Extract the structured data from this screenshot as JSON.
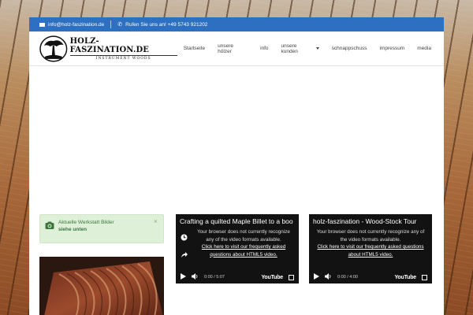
{
  "topbar": {
    "email": "info@holz-faszination.de",
    "phone_label": "Rufen Sie uns an! +49 5743 921202"
  },
  "logo": {
    "title": "HOLZ-FASZINATION.DE",
    "subtitle": "INSTRUMENT WOODS"
  },
  "nav": {
    "items": [
      {
        "label": "Startseite"
      },
      {
        "label": "unsere hölzer"
      },
      {
        "label": "info"
      },
      {
        "label": "unsere kunden"
      },
      {
        "label": "schnappschuss"
      },
      {
        "label": "impressum"
      },
      {
        "label": "media"
      }
    ]
  },
  "alert": {
    "line1": "Aktuelle Werkstatt Bilder",
    "line2": "siehe unten",
    "close": "×"
  },
  "videos": [
    {
      "title": "Crafting a quilted Maple Billet to a boo",
      "message": "Your browser does not currently recognize any of the video formats available.",
      "link": "Click here to visit our frequently asked questions about HTML5 video.",
      "time": "0:00 / 5:07",
      "brand": "YouTube"
    },
    {
      "title": "holz-faszination - Wood-Stock Tour",
      "message": "Your browser does not currently recognize any of the video formats available.",
      "link": "Click here to visit our frequently asked questions about HTML5 video.",
      "time": "0:00 / 4:00",
      "brand": "YouTube"
    }
  ],
  "colors": {
    "topbar": "#2d6fc0",
    "alert_bg": "#dff0d8",
    "alert_text": "#3c763d",
    "video_bg": "#121212"
  }
}
